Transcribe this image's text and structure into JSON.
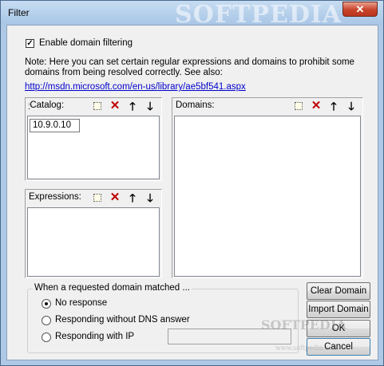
{
  "window": {
    "title": "Filter",
    "close_label": "✕",
    "watermark": "SOFTPEDIA",
    "watermark_small": "www.softpedia.com"
  },
  "filtering": {
    "enable_label": "Enable domain filtering",
    "enabled": true
  },
  "note": {
    "line1": "Note: Here you can set certain regular expressions and domains to  prohibit some",
    "line2": "domains from being resolved correctly. See also:",
    "link": "http://msdn.microsoft.com/en-us/library/ae5bf541.aspx"
  },
  "catalog": {
    "label": "Catalog:",
    "value": "10.9.0.10"
  },
  "expressions": {
    "label": "Expressions:"
  },
  "domains": {
    "label": "Domains:"
  },
  "toolbar_icons": [
    "new-icon",
    "delete-icon",
    "move-up-icon",
    "move-down-icon"
  ],
  "match_group": {
    "title": "When a requested domain matched ...",
    "options": [
      {
        "label": "No response",
        "selected": true
      },
      {
        "label": "Responding without DNS answer",
        "selected": false
      },
      {
        "label": "Responding with IP",
        "selected": false
      }
    ],
    "ip_value": ""
  },
  "buttons": {
    "clear_domain": "Clear Domain",
    "import_domain": "Import Domain",
    "ok": "OK",
    "cancel": "Cancel"
  }
}
